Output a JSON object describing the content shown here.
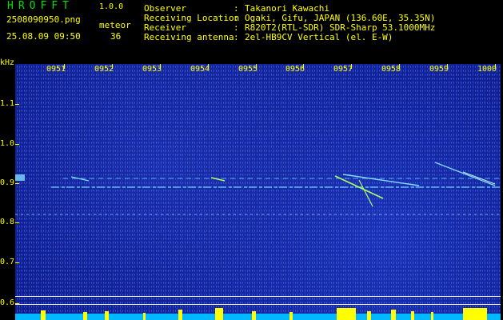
{
  "header": {
    "logo": "HROFFT",
    "version": "1.0.0",
    "filename": "2508090950.png",
    "meteor_label": "meteor",
    "datetime": "25.08.09 09:50",
    "meteor_count": "36",
    "info": [
      {
        "label": "Observer",
        "value": "Takanori Kawachi"
      },
      {
        "label": "Receiving Location",
        "value": "Ogaki, Gifu, JAPAN (136.60E, 35.35N)"
      },
      {
        "label": "Receiver",
        "value": "R820T2(RTL-SDR) SDR-Sharp 53.1000MHz"
      },
      {
        "label": "Receiving antenna",
        "value": "2el-HB9CV Vertical (el. E-W)"
      }
    ]
  },
  "spectrogram": {
    "y_unit": "kHz",
    "y_labels": [
      "1.1",
      "1.0",
      "0.9",
      "0.8",
      "0.7",
      "0.6"
    ],
    "x_labels": [
      "0951",
      "0952",
      "0953",
      "0954",
      "0955",
      "0956",
      "0957",
      "0958",
      "0959",
      "1000"
    ],
    "colors": {
      "background": "#0c1a86",
      "text": "#ffff00",
      "trace": "#7fdcff",
      "meteor": "#a8ff60"
    }
  }
}
